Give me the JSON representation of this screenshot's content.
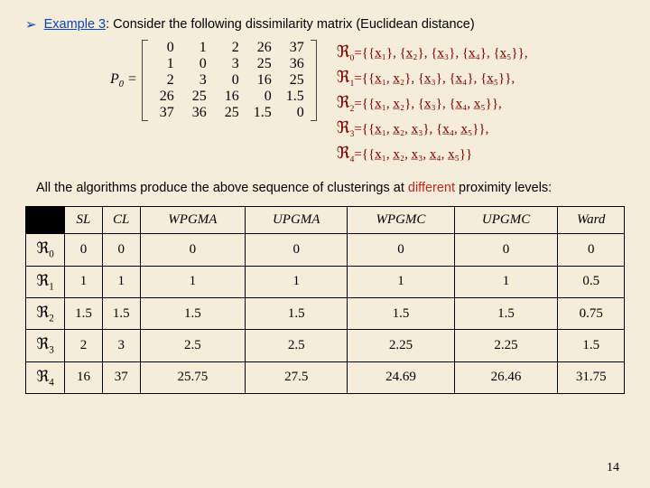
{
  "heading": {
    "label": "Example 3",
    "rest": ": Consider the following dissimilarity matrix (Euclidean distance)"
  },
  "matrix": {
    "label": "P",
    "sub": "0",
    "rows": [
      [
        "0",
        "1",
        "2",
        "26",
        "37"
      ],
      [
        "1",
        "0",
        "3",
        "25",
        "36"
      ],
      [
        "2",
        "3",
        "0",
        "16",
        "25"
      ],
      [
        "26",
        "25",
        "16",
        "0",
        "1.5"
      ],
      [
        "37",
        "36",
        "25",
        "1.5",
        "0"
      ]
    ]
  },
  "clusterings": [
    {
      "r": "0",
      "body": "={{x̲₁}, {x̲₂}, {x̲₃}, {x̲₄}, {x̲₅}},"
    },
    {
      "r": "1",
      "body": "={{x̲₁, x̲₂}, {x̲₃}, {x̲₄}, {x̲₅}},"
    },
    {
      "r": "2",
      "body": "={{x̲₁, x̲₂}, {x̲₃}, {x̲₄, x̲₅}},"
    },
    {
      "r": "3",
      "body": "={{x̲₁, x̲₂, x̲₃}, {x̲₄, x̲₅}},"
    },
    {
      "r": "4",
      "body": "={{x̲₁, x̲₂, x̲₃, x̲₄, x̲₅}}"
    }
  ],
  "bottom_text": {
    "pre": "All the algorithms produce the above sequence of clusterings at ",
    "diff": "different",
    "post": " proximity levels:"
  },
  "table": {
    "columns": [
      "SL",
      "CL",
      "WPGMA",
      "UPGMA",
      "WPGMC",
      "UPGMC",
      "Ward"
    ],
    "rowheads": [
      "0",
      "1",
      "2",
      "3",
      "4"
    ],
    "data": [
      [
        "0",
        "0",
        "0",
        "0",
        "0",
        "0",
        "0"
      ],
      [
        "1",
        "1",
        "1",
        "1",
        "1",
        "1",
        "0.5"
      ],
      [
        "1.5",
        "1.5",
        "1.5",
        "1.5",
        "1.5",
        "1.5",
        "0.75"
      ],
      [
        "2",
        "3",
        "2.5",
        "2.5",
        "2.25",
        "2.25",
        "1.5"
      ],
      [
        "16",
        "37",
        "25.75",
        "27.5",
        "24.69",
        "26.46",
        "31.75"
      ]
    ]
  },
  "chart_data": {
    "type": "table",
    "title": "Proximity levels at which each clustering R0..R4 is produced by each algorithm",
    "columns": [
      "SL",
      "CL",
      "WPGMA",
      "UPGMA",
      "WPGMC",
      "UPGMC",
      "Ward"
    ],
    "row_labels": [
      "R0",
      "R1",
      "R2",
      "R3",
      "R4"
    ],
    "values": [
      [
        0,
        0,
        0,
        0,
        0,
        0,
        0
      ],
      [
        1,
        1,
        1,
        1,
        1,
        1,
        0.5
      ],
      [
        1.5,
        1.5,
        1.5,
        1.5,
        1.5,
        1.5,
        0.75
      ],
      [
        2,
        3,
        2.5,
        2.5,
        2.25,
        2.25,
        1.5
      ],
      [
        16,
        37,
        25.75,
        27.5,
        24.69,
        26.46,
        31.75
      ]
    ]
  },
  "page_number": "14"
}
